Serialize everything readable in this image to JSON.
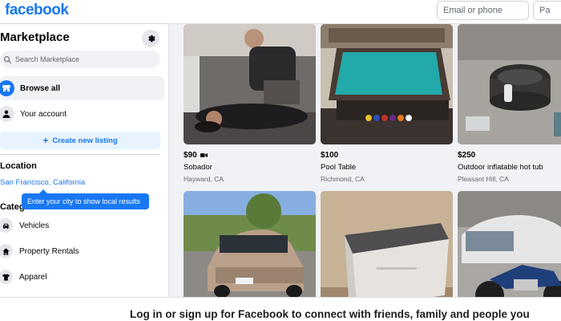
{
  "header": {
    "logo": "facebook",
    "email_placeholder": "Email or phone",
    "password_placeholder": "Pa"
  },
  "sidebar": {
    "title": "Marketplace",
    "search_placeholder": "Search Marketplace",
    "nav": [
      {
        "label": "Browse all",
        "icon": "storefront-icon"
      },
      {
        "label": "Your account",
        "icon": "person-icon"
      }
    ],
    "create_label": "Create new listing",
    "location_heading": "Location",
    "location_value": "San Francisco, California",
    "location_tooltip": "Enter your city to show local results",
    "categories_heading": "Categories",
    "categories": [
      {
        "label": "Vehicles",
        "icon": "car-icon"
      },
      {
        "label": "Property Rentals",
        "icon": "house-icon"
      },
      {
        "label": "Apparel",
        "icon": "shirt-icon"
      }
    ]
  },
  "listings": [
    {
      "price": "$90",
      "has_video": true,
      "title": "Sobador",
      "location": "Hayward, CA"
    },
    {
      "price": "$100",
      "has_video": false,
      "title": "Pool Table",
      "location": "Richmond, CA"
    },
    {
      "price": "$250",
      "has_video": false,
      "title": "Outdoor inflatable hot tub",
      "location": "Pleasant Hill, CA"
    },
    {
      "price": "",
      "has_video": false,
      "title": "",
      "location": ""
    },
    {
      "price": "",
      "has_video": false,
      "title": "",
      "location": ""
    },
    {
      "price": "",
      "has_video": false,
      "title": "",
      "location": ""
    }
  ],
  "banner": {
    "text": "Log in or sign up for Facebook to connect with friends, family and people you"
  },
  "colors": {
    "brand": "#1877f2",
    "background": "#f0f2f5",
    "text_secondary": "#65676b"
  }
}
